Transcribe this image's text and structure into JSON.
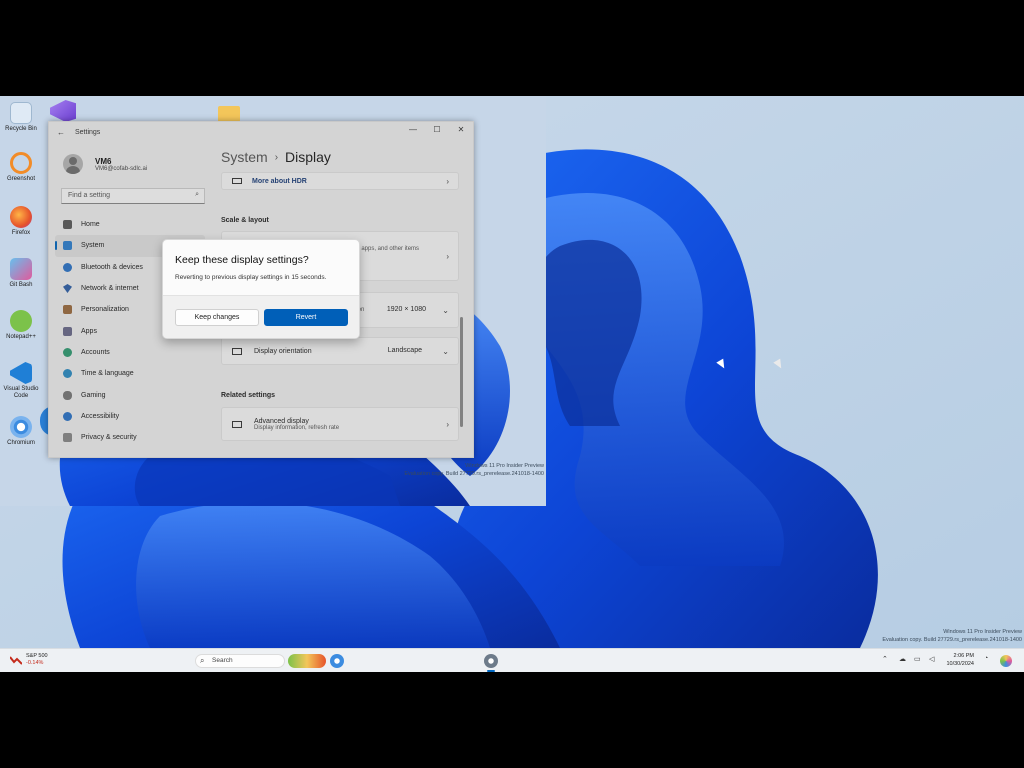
{
  "desktop": {
    "icons": [
      {
        "label": "Recycle Bin",
        "color": "#5fa7d8"
      },
      {
        "label": "Greenshot",
        "color": "#f28c28"
      },
      {
        "label": "Firefox",
        "color": "#e6542a"
      },
      {
        "label": "Git Bash",
        "color": "#4fb0e0"
      },
      {
        "label": "Notepad++",
        "color": "#7cc24a"
      },
      {
        "label": "Visual Studio Code",
        "color": "#1f7fd6"
      },
      {
        "label": "Chromium",
        "color": "#3c8ce0"
      }
    ]
  },
  "settings_window": {
    "title": "Settings",
    "user_name": "VM6",
    "user_email": "VM6@cofab-sdlc.ai",
    "search_placeholder": "Find a setting",
    "nav": [
      {
        "label": "Home",
        "icon": "home-icon",
        "color": "#5a5a5a"
      },
      {
        "label": "System",
        "icon": "monitor-icon",
        "color": "#2d7fd0",
        "active": true
      },
      {
        "label": "Bluetooth & devices",
        "icon": "bluetooth-icon",
        "color": "#2a73c8"
      },
      {
        "label": "Network & internet",
        "icon": "wifi-icon",
        "color": "#2c5fa8"
      },
      {
        "label": "Personalization",
        "icon": "brush-icon",
        "color": "#9b6b3e"
      },
      {
        "label": "Apps",
        "icon": "apps-icon",
        "color": "#6a6a8a"
      },
      {
        "label": "Accounts",
        "icon": "person-icon",
        "color": "#2f9c72"
      },
      {
        "label": "Time & language",
        "icon": "globe-icon",
        "color": "#2a8cc4"
      },
      {
        "label": "Gaming",
        "icon": "controller-icon",
        "color": "#777777"
      },
      {
        "label": "Accessibility",
        "icon": "accessibility-icon",
        "color": "#2a73c8"
      },
      {
        "label": "Privacy & security",
        "icon": "shield-icon",
        "color": "#888888"
      }
    ],
    "breadcrumb": {
      "parent": "System",
      "separator": "›",
      "current": "Display"
    },
    "hdr_link": "More about HDR",
    "section_scale": "Scale & layout",
    "scale_partial": "ext, apps, and other items",
    "resolution_partial": "lution",
    "resolution_value": "1920 × 1080",
    "orientation_label": "Display orientation",
    "orientation_value": "Landscape",
    "section_related": "Related settings",
    "advanced_title": "Advanced display",
    "advanced_sub": "Display information, refresh rate"
  },
  "dialog": {
    "title": "Keep these display settings?",
    "message": "Reverting to previous display settings in 15 seconds.",
    "keep_label": "Keep changes",
    "revert_label": "Revert"
  },
  "watermark_inner": {
    "line1": "Windows 11 Pro Insider Preview",
    "line2": "Evaluation copy. Build 27729.rs_prerelease.241018-1400"
  },
  "watermark_outer": {
    "line1": "Windows 11 Pro Insider Preview",
    "line2": "Evaluation copy. Build 27729.rs_prerelease.241018-1400"
  },
  "taskbar": {
    "stock_name": "S&P 500",
    "stock_change": "-0.14%",
    "search_placeholder": "Search",
    "time": "2:06 PM",
    "date": "10/30/2024",
    "accent": "#0067c0"
  }
}
